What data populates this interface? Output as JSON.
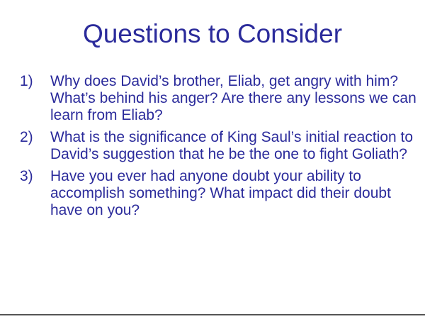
{
  "slide": {
    "title": "Questions to Consider",
    "questions": [
      {
        "number": "1)",
        "text": "Why does David’s brother, Eliab, get angry with him?  What’s behind his anger?  Are there any lessons we can learn from Eliab?"
      },
      {
        "number": "2)",
        "text": "What is the significance of King Saul’s initial reaction to David’s suggestion that he be the one to fight Goliath?"
      },
      {
        "number": "3)",
        "text": "Have you ever had anyone doubt your ability to accomplish something?  What impact did their doubt have on you?"
      }
    ]
  },
  "colors": {
    "text": "#2b2b9b",
    "background": "#ffffff",
    "divider": "#555555"
  }
}
